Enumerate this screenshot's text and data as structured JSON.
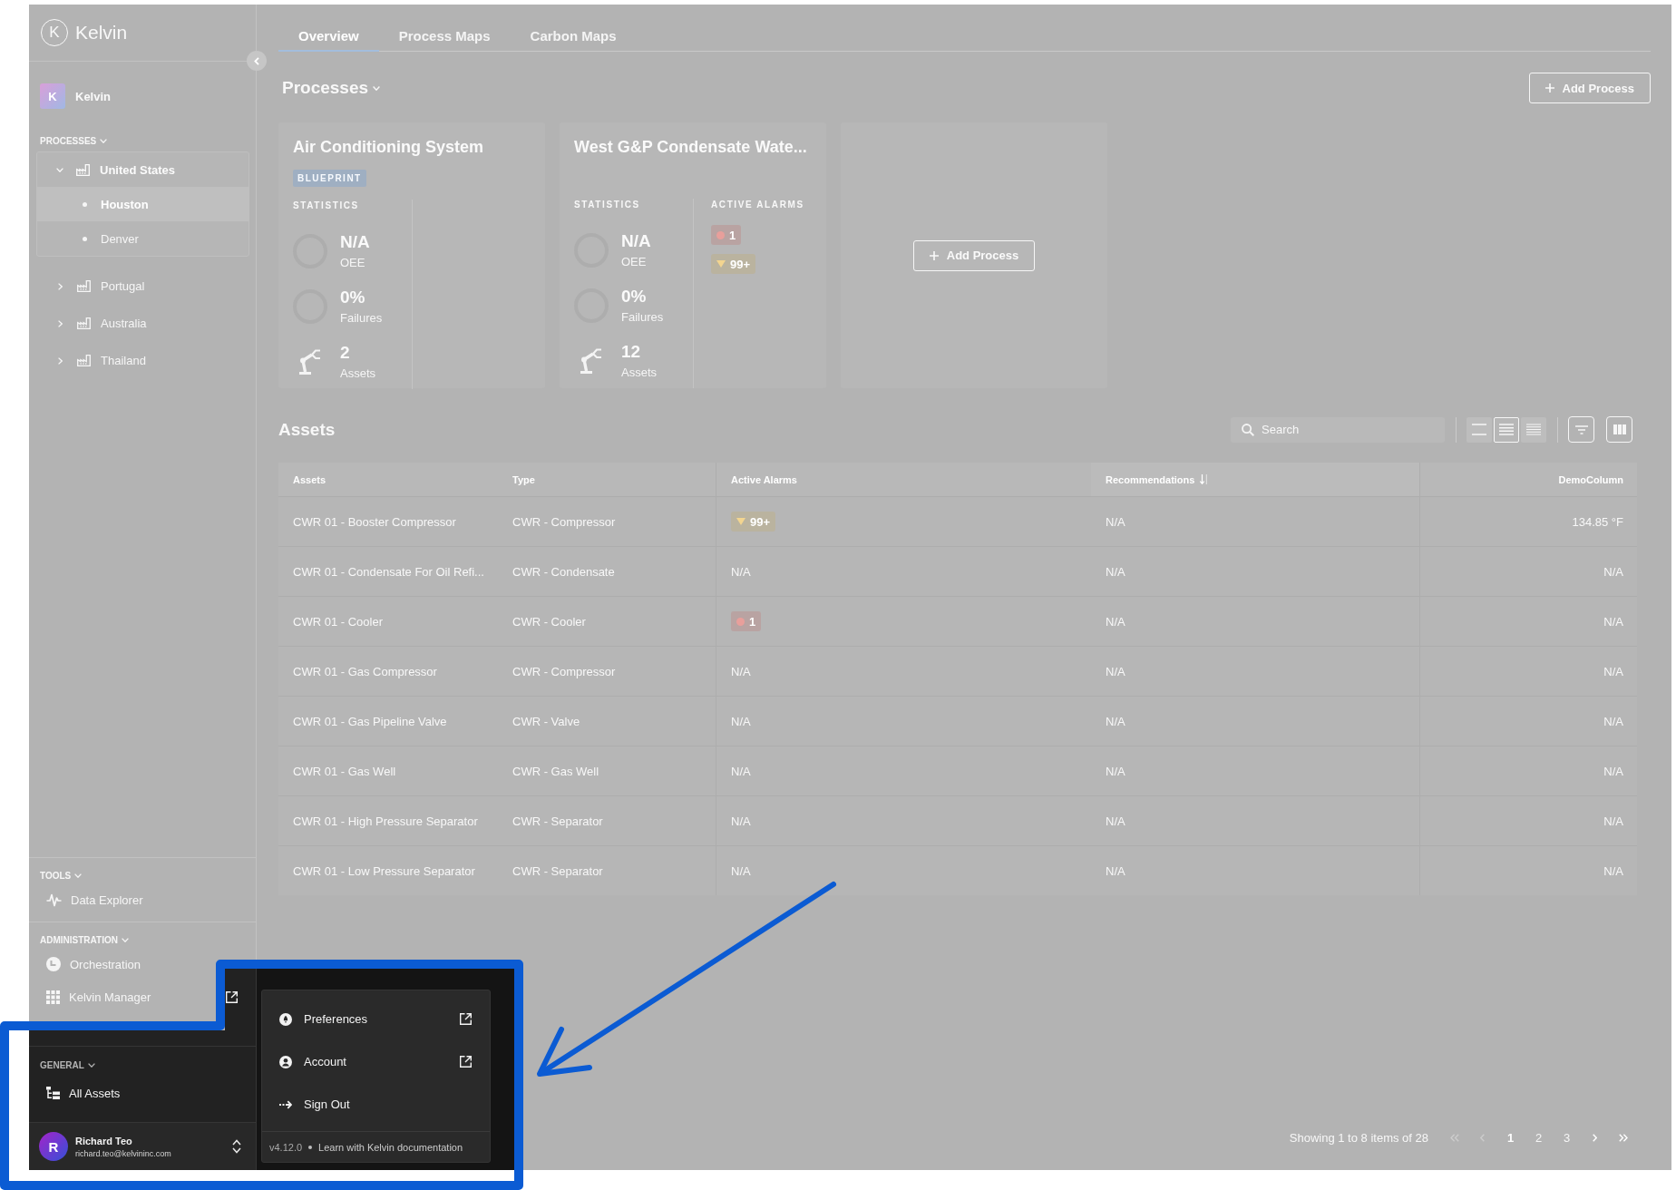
{
  "sidebar": {
    "logo": {
      "mark": "K",
      "text": "Kelvin"
    },
    "workspace": {
      "initial": "K",
      "name": "Kelvin"
    },
    "processes": {
      "heading": "PROCESSES",
      "expanded": true,
      "items": [
        {
          "label": "United States",
          "expanded": true,
          "children": [
            {
              "label": "Houston",
              "selected": true
            },
            {
              "label": "Denver",
              "selected": false
            }
          ]
        },
        {
          "label": "Portugal",
          "expanded": false
        },
        {
          "label": "Australia",
          "expanded": false
        },
        {
          "label": "Thailand",
          "expanded": false
        }
      ]
    },
    "sections": [
      {
        "heading": "TOOLS",
        "expanded": true,
        "items": [
          {
            "kind": "explorer",
            "label": "Data Explorer",
            "external": false
          }
        ]
      },
      {
        "heading": "ADMINISTRATION",
        "expanded": true,
        "items": [
          {
            "kind": "orchestration",
            "label": "Orchestration",
            "external": false
          },
          {
            "kind": "manager",
            "label": "Kelvin Manager",
            "external": true
          }
        ]
      }
    ],
    "footer": {
      "heading": "GENERAL",
      "expanded": true,
      "items": [
        {
          "kind": "assets",
          "label": "All Assets",
          "external": false
        }
      ]
    },
    "user": {
      "initial": "R",
      "name": "Richard Teo",
      "email": "richard.teo@kelvininc.com"
    }
  },
  "tabs": [
    {
      "label": "Overview",
      "selected": true
    },
    {
      "label": "Process Maps",
      "selected": false
    },
    {
      "label": "Carbon Maps",
      "selected": false
    }
  ],
  "processes": {
    "title": "Processes",
    "add_button": "Add Process",
    "cards": [
      {
        "kind": "process",
        "title": "Air Conditioning System",
        "tag": "BLUEPRINT",
        "statistics_label": "STATISTICS",
        "stats": [
          {
            "kind": "gauge",
            "value": "N/A",
            "label": "OEE"
          },
          {
            "kind": "gauge",
            "value": "0%",
            "label": "Failures"
          },
          {
            "kind": "assets",
            "value": "2",
            "label": "Assets"
          }
        ]
      },
      {
        "kind": "process",
        "title": "West G&P Condensate Wate...",
        "statistics_label": "STATISTICS",
        "stats": [
          {
            "kind": "gauge",
            "value": "N/A",
            "label": "OEE"
          },
          {
            "kind": "gauge",
            "value": "0%",
            "label": "Failures"
          },
          {
            "kind": "assets",
            "value": "12",
            "label": "Assets"
          }
        ],
        "alarms_label": "ACTIVE ALARMS",
        "alarms": [
          {
            "kind": "critical",
            "label": "1"
          },
          {
            "kind": "warning",
            "label": "99+"
          }
        ]
      },
      {
        "kind": "add",
        "button": "Add Process"
      }
    ]
  },
  "assets": {
    "title": "Assets",
    "search": {
      "placeholder": "Search"
    },
    "density": [
      {
        "kind": "compact",
        "selected": false
      },
      {
        "kind": "regular",
        "selected": true
      },
      {
        "kind": "dense",
        "selected": false
      }
    ],
    "columns": [
      {
        "label": "Assets",
        "sorted": false
      },
      {
        "label": "Type",
        "sorted": false
      },
      {
        "label": "Active Alarms",
        "sorted": false
      },
      {
        "label": "Recommendations",
        "sorted": true
      },
      {
        "label": "DemoColumn",
        "sorted": false
      }
    ],
    "rows": [
      {
        "asset": "CWR 01 - Booster Compressor",
        "type": "CWR - Compressor",
        "alarm": {
          "kind": "warning",
          "label": "99+"
        },
        "recommendations": "N/A",
        "demo": "134.85 °F"
      },
      {
        "asset": "CWR 01 - Condensate For Oil Refi...",
        "type": "CWR - Condensate",
        "alarm": {
          "kind": "text",
          "label": "N/A"
        },
        "recommendations": "N/A",
        "demo": "N/A"
      },
      {
        "asset": "CWR 01 - Cooler",
        "type": "CWR - Cooler",
        "alarm": {
          "kind": "critical",
          "label": "1"
        },
        "recommendations": "N/A",
        "demo": "N/A"
      },
      {
        "asset": "CWR 01 - Gas Compressor",
        "type": "CWR - Compressor",
        "alarm": {
          "kind": "text",
          "label": "N/A"
        },
        "recommendations": "N/A",
        "demo": "N/A"
      },
      {
        "asset": "CWR 01 - Gas Pipeline Valve",
        "type": "CWR - Valve",
        "alarm": {
          "kind": "text",
          "label": "N/A"
        },
        "recommendations": "N/A",
        "demo": "N/A"
      },
      {
        "asset": "CWR 01 - Gas Well",
        "type": "CWR - Gas Well",
        "alarm": {
          "kind": "text",
          "label": "N/A"
        },
        "recommendations": "N/A",
        "demo": "N/A"
      },
      {
        "asset": "CWR 01 - High Pressure Separator",
        "type": "CWR - Separator",
        "alarm": {
          "kind": "text",
          "label": "N/A"
        },
        "recommendations": "N/A",
        "demo": "N/A"
      },
      {
        "asset": "CWR 01 - Low Pressure Separator",
        "type": "CWR - Separator",
        "alarm": {
          "kind": "text",
          "label": "N/A"
        },
        "recommendations": "N/A",
        "demo": "N/A"
      }
    ],
    "pagination": {
      "summary": "Showing 1 to 8 items of 28",
      "first": {
        "disabled": true
      },
      "previous": {
        "disabled": true
      },
      "pages": [
        {
          "label": "1",
          "selected": true
        },
        {
          "label": "2",
          "selected": false
        },
        {
          "label": "3",
          "selected": false
        }
      ],
      "next": {
        "disabled": false
      },
      "last": {
        "disabled": false
      }
    }
  },
  "user_menu": {
    "items": [
      {
        "kind": "preferences",
        "label": "Preferences",
        "external": true
      },
      {
        "kind": "account",
        "label": "Account",
        "external": true
      },
      {
        "kind": "sign_out",
        "label": "Sign Out",
        "external": false
      }
    ],
    "version": "v4.12.0",
    "link": "Learn with Kelvin documentation"
  }
}
